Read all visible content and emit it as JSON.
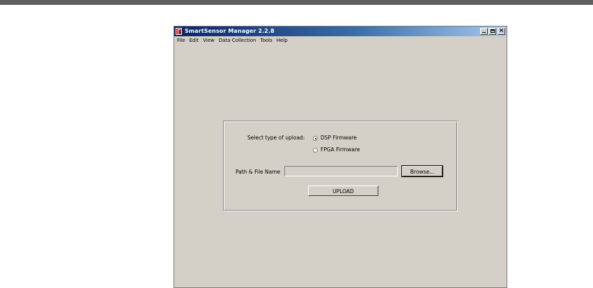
{
  "window": {
    "title": "SmartSensor Manager 2.2.8"
  },
  "menu": {
    "items": [
      "File",
      "Edit",
      "View",
      "Data Collection",
      "Tools",
      "Help"
    ]
  },
  "upload_form": {
    "select_label": "Select type of upload:",
    "options": [
      {
        "label": "DSP Firmware",
        "checked": true
      },
      {
        "label": "FPGA Firmware",
        "checked": false
      }
    ],
    "path_label": "Path & File Name",
    "path_value": "",
    "browse_label": "Browse...",
    "upload_label": "UPLOAD"
  }
}
